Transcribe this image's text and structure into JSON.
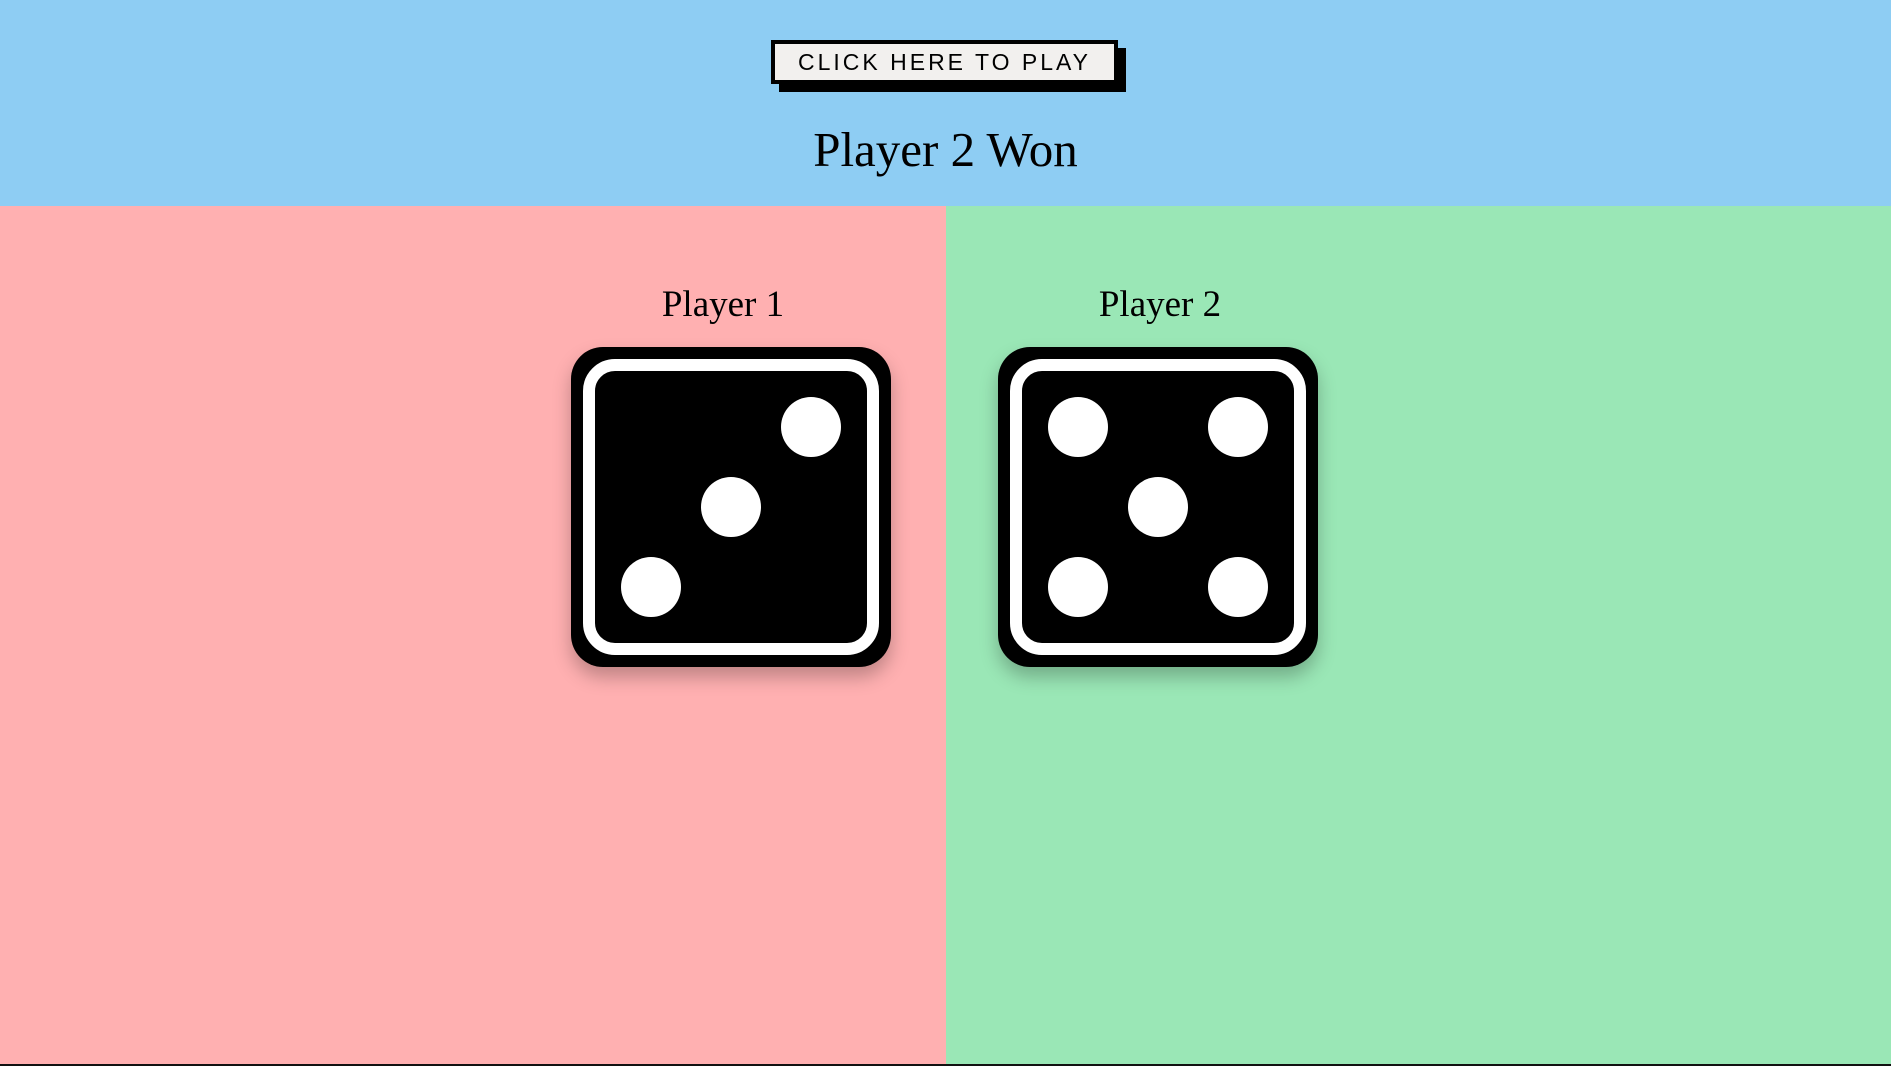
{
  "header": {
    "play_button_label": "CLICK HERE TO PLAY",
    "result_title": "Player 2 Won"
  },
  "players": [
    {
      "label": "Player 1",
      "die_value": 3
    },
    {
      "label": "Player 2",
      "die_value": 5
    }
  ],
  "colors": {
    "header_bg": "#8ecdf3",
    "player1_bg": "#ffb0b1",
    "player2_bg": "#9ae7b6",
    "die_body": "#000000",
    "die_pip": "#ffffff"
  }
}
